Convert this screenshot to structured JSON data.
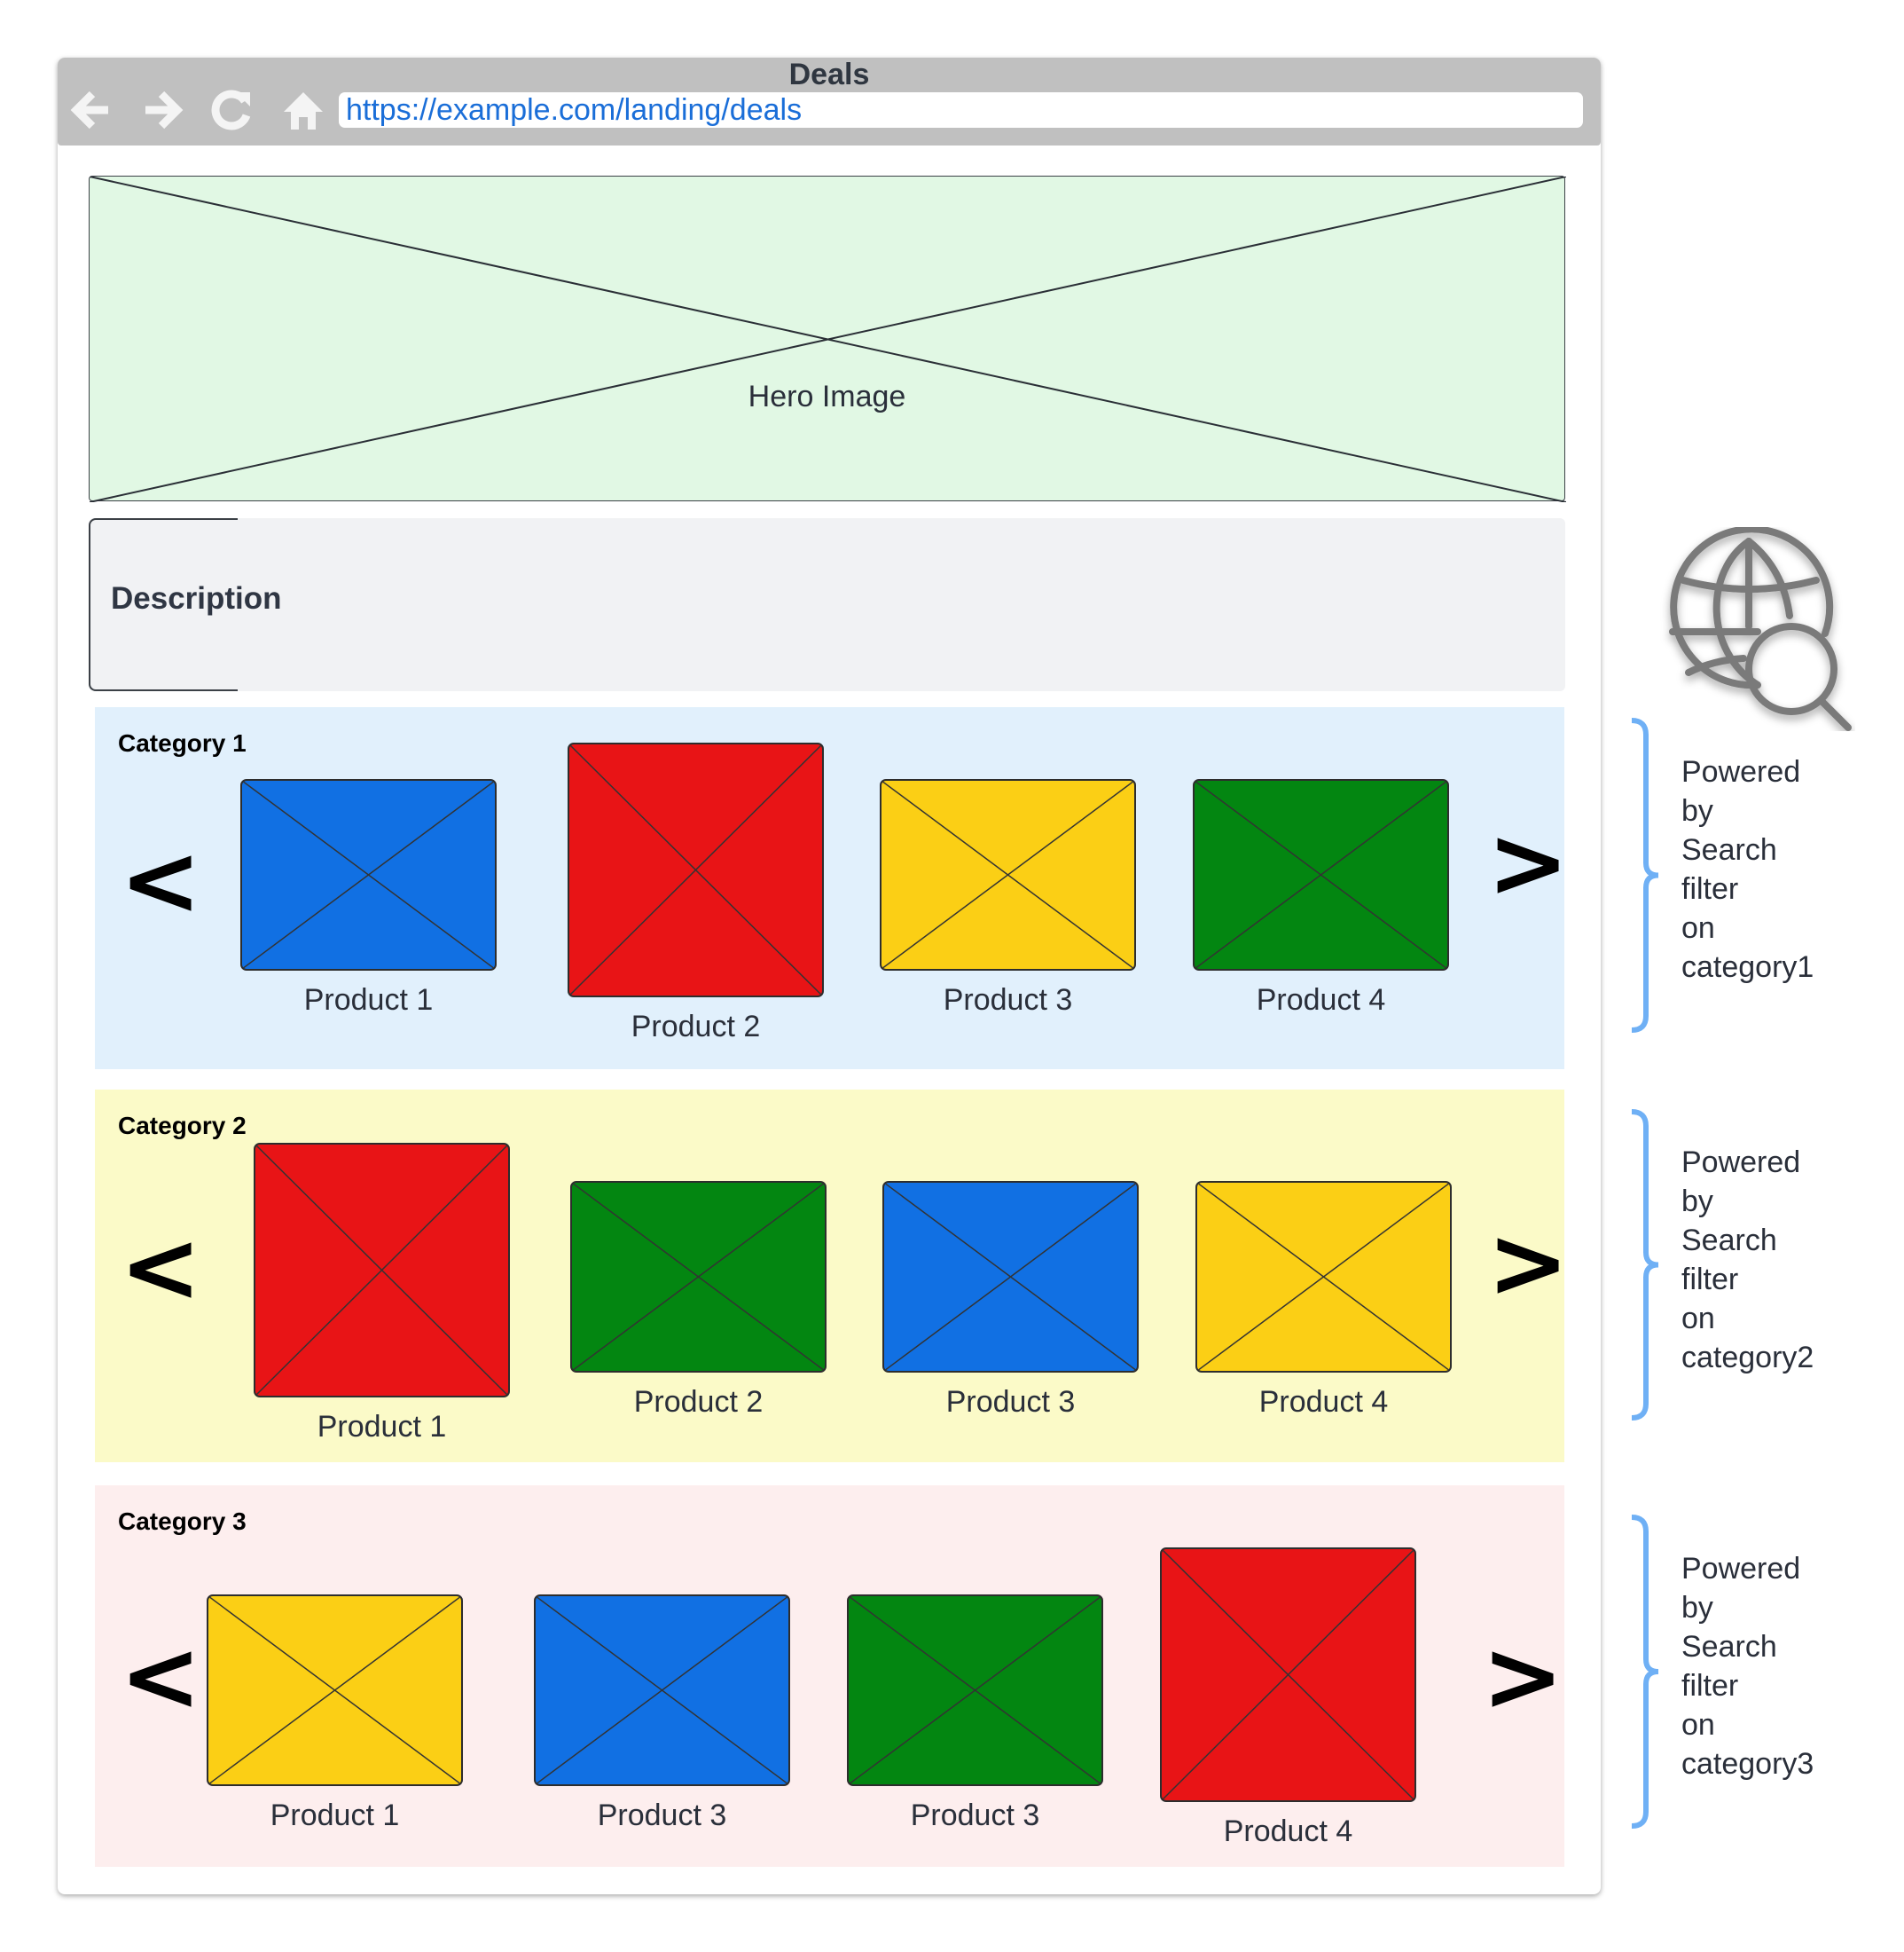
{
  "browser": {
    "title": "Deals",
    "url": "https://example.com/landing/deals",
    "nav_icons": [
      "back-arrow-icon",
      "forward-arrow-icon",
      "reload-icon",
      "home-icon"
    ]
  },
  "hero": {
    "label": "Hero Image",
    "color": "#e1f8e4"
  },
  "description": {
    "label": "Description",
    "color": "#f1f2f4"
  },
  "colors": {
    "blue": "#1170e3",
    "red": "#e81416",
    "yellow": "#fbcf15",
    "green": "#038611",
    "bracket": "#6fb0f5",
    "globe": "#7a7a7a"
  },
  "categories": [
    {
      "title": "Category 1",
      "background": "#e1f0fc",
      "prev_label": "<",
      "next_label": ">",
      "products": [
        {
          "label": "Product 1",
          "color": "blue",
          "featured": false
        },
        {
          "label": "Product 2",
          "color": "red",
          "featured": true
        },
        {
          "label": "Product 3",
          "color": "yellow",
          "featured": false
        },
        {
          "label": "Product 4",
          "color": "green",
          "featured": false
        }
      ],
      "annotation": [
        "Powered",
        "by",
        "Search",
        "filter",
        "on",
        "category1"
      ]
    },
    {
      "title": "Category 2",
      "background": "#fbfac8",
      "prev_label": "<",
      "next_label": ">",
      "products": [
        {
          "label": "Product 1",
          "color": "red",
          "featured": true
        },
        {
          "label": "Product 2",
          "color": "green",
          "featured": false
        },
        {
          "label": "Product 3",
          "color": "blue",
          "featured": false
        },
        {
          "label": "Product 4",
          "color": "yellow",
          "featured": false
        }
      ],
      "annotation": [
        "Powered",
        "by",
        "Search",
        "filter",
        "on",
        "category2"
      ]
    },
    {
      "title": "Category 3",
      "background": "#fdeeee",
      "prev_label": "<",
      "next_label": ">",
      "products": [
        {
          "label": "Product 1",
          "color": "yellow",
          "featured": false
        },
        {
          "label": "Product 3",
          "color": "blue",
          "featured": false
        },
        {
          "label": "Product 3",
          "color": "green",
          "featured": false
        },
        {
          "label": "Product 4",
          "color": "red",
          "featured": true
        }
      ],
      "annotation": [
        "Powered",
        "by",
        "Search",
        "filter",
        "on",
        "category3"
      ]
    }
  ],
  "side_icon": "globe-search-icon"
}
